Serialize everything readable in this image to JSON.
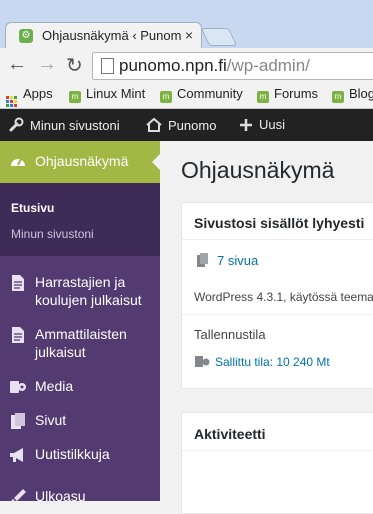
{
  "browser": {
    "tab_title": "Ohjausnäkymä ‹ Punomo",
    "close_glyph": "×",
    "url_host": "punomo.npn.fi",
    "url_path": "/wp-admin/"
  },
  "bookmarks": [
    {
      "label": "Apps"
    },
    {
      "label": "Linux Mint"
    },
    {
      "label": "Community"
    },
    {
      "label": "Forums"
    },
    {
      "label": "Blog"
    }
  ],
  "adminbar": {
    "my_sites": "Minun sivustoni",
    "site_name": "Punomo",
    "new_label": "Uusi"
  },
  "sidebar": {
    "active": "Ohjausnäkymä",
    "submenu": [
      "Etusivu",
      "Minun sivustoni"
    ],
    "items": [
      {
        "label": "Harrastajien ja koulujen julkaisut",
        "icon": "document-icon"
      },
      {
        "label": "Ammattilaisten julkaisut",
        "icon": "document-icon"
      },
      {
        "label": "Media",
        "icon": "media-icon"
      },
      {
        "label": "Sivut",
        "icon": "pages-icon"
      },
      {
        "label": "Uutistilkkuja",
        "icon": "megaphone-icon"
      },
      {
        "label": "Ulkoasu",
        "icon": "brush-icon"
      }
    ]
  },
  "main": {
    "title": "Ohjausnäkymä",
    "glance": {
      "title": "Sivustosi sisällöt lyhyesti",
      "pages_link": "7 sivua",
      "version_text": "WordPress 4.3.1, käytössä teema",
      "storage_label": "Tallennustila",
      "storage_link": "Sallittu tila: 10 240 Mt"
    },
    "activity": {
      "title": "Aktiviteetti"
    }
  },
  "colors": {
    "sidebar": "#533a70",
    "active": "#a3b745",
    "adminbar": "#222222",
    "link": "#0073aa"
  }
}
